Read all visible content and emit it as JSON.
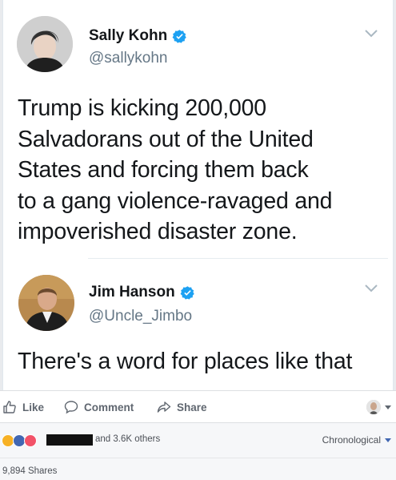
{
  "tweets": [
    {
      "name": "Sally Kohn",
      "handle": "@sallykohn",
      "text": "Trump is kicking 200,000 Salvadorans out of the United States and forcing them back to a gang violence-ravaged and impoverished disaster zone.",
      "lines": [
        "Trump is kicking 200,000",
        "Salvadorans out of the United",
        "States and forcing them back",
        "to a gang violence-ravaged and",
        "impoverished disaster zone."
      ]
    },
    {
      "name": "Jim Hanson",
      "handle": "@Uncle_Jimbo",
      "text": "There's a word for places like that"
    }
  ],
  "actions": {
    "like": "Like",
    "comment": "Comment",
    "share": "Share"
  },
  "reactions": {
    "icons": [
      "haha",
      "like",
      "love"
    ],
    "others_text": "and 3.6K others",
    "sort_label": "Chronological"
  },
  "shares": "9,894 Shares",
  "colors": {
    "verified": "#1da1f2",
    "fb_blue": "#4267b2",
    "text_gray": "#657786"
  }
}
